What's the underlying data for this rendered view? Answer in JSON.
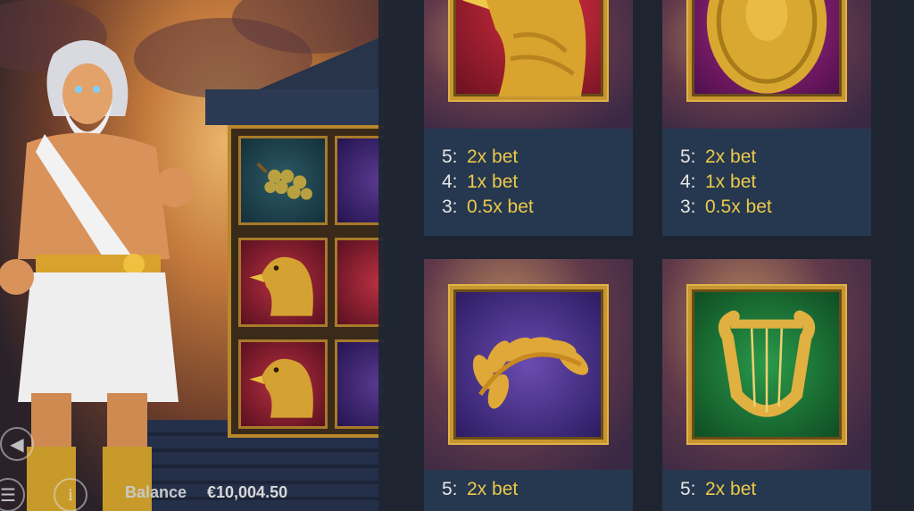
{
  "game": {
    "balance_label": "Balance",
    "balance_value": "€10,004.50",
    "sound_icon": "speaker-icon",
    "info_icon": "info-icon",
    "menu_icon": "hamburger-icon"
  },
  "paytable": {
    "cards": [
      {
        "symbol": "eagle",
        "lines": [
          {
            "count": "5:",
            "value": "2x bet"
          },
          {
            "count": "4:",
            "value": "1x bet"
          },
          {
            "count": "3:",
            "value": "0.5x bet"
          }
        ]
      },
      {
        "symbol": "medusa-coin",
        "lines": [
          {
            "count": "5:",
            "value": "2x bet"
          },
          {
            "count": "4:",
            "value": "1x bet"
          },
          {
            "count": "3:",
            "value": "0.5x bet"
          }
        ]
      },
      {
        "symbol": "laurel-wreath",
        "lines": [
          {
            "count": "5:",
            "value": "2x bet"
          }
        ]
      },
      {
        "symbol": "golden-lyre",
        "lines": [
          {
            "count": "5:",
            "value": "2x bet"
          }
        ]
      }
    ]
  },
  "colors": {
    "payout_value": "#ecc94a",
    "panel_bg": "#26384f",
    "frame_gold": "#c8962e"
  }
}
